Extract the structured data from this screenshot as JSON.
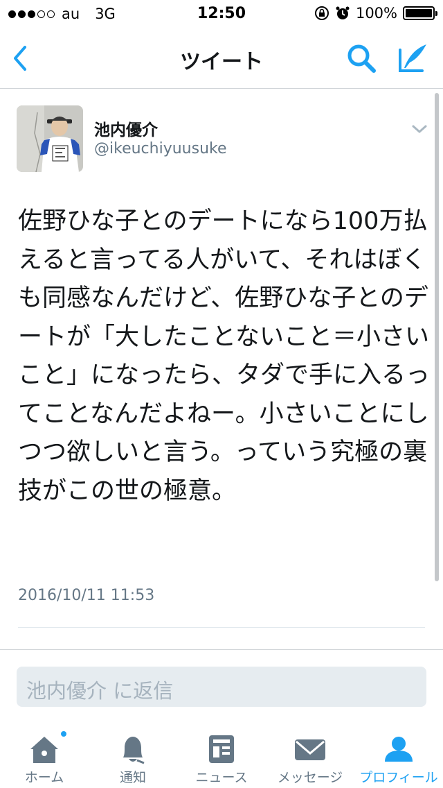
{
  "status_bar": {
    "carrier": "au",
    "network": "3G",
    "time": "12:50",
    "battery": "100%",
    "battery_level": 1.0,
    "signal_bars_filled": 3,
    "signal_bars_total": 5
  },
  "nav": {
    "title": "ツイート",
    "back_icon": "chevron-left-icon",
    "search_icon": "search-icon",
    "compose_icon": "compose-icon",
    "accent_color": "#1da1f2"
  },
  "tweet": {
    "author_name": "池内優介",
    "author_handle": "@ikeuchiyuusuke",
    "text": "佐野ひな子とのデートになら100万払えると言ってる人がいて、それはぼくも同感なんだけど、佐野ひな子とのデートが「大したことないこと＝小さいこと」になったら、タダで手に入るってことなんだよねー。小さいことにしつつ欲しいと言う。っていう究極の裏技がこの世の極意。",
    "timestamp": "2016/10/11 11:53"
  },
  "reply": {
    "placeholder": "池内優介 に返信"
  },
  "tabs": [
    {
      "label": "ホーム",
      "icon": "home-icon",
      "active": false,
      "has_badge": true
    },
    {
      "label": "通知",
      "icon": "bell-icon",
      "active": false,
      "has_badge": false
    },
    {
      "label": "ニュース",
      "icon": "news-icon",
      "active": false,
      "has_badge": false
    },
    {
      "label": "メッセージ",
      "icon": "envelope-icon",
      "active": false,
      "has_badge": false
    },
    {
      "label": "プロフィール",
      "icon": "profile-icon",
      "active": true,
      "has_badge": false
    }
  ]
}
